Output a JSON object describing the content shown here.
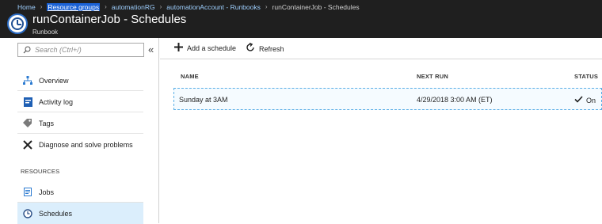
{
  "breadcrumb": [
    {
      "label": "Home",
      "style": "link"
    },
    {
      "label": "Resource groups",
      "style": "active-link"
    },
    {
      "label": "automationRG",
      "style": "link"
    },
    {
      "label": "automationAccount - Runbooks",
      "style": "link"
    },
    {
      "label": "runContainerJob - Schedules",
      "style": "plain"
    }
  ],
  "header": {
    "title": "runContainerJob - Schedules",
    "subtitle": "Runbook",
    "icon": "clock-icon"
  },
  "sidebar": {
    "search_placeholder": "Search (Ctrl+/)",
    "collapse_glyph": "«",
    "items": [
      {
        "label": "Overview",
        "icon": "overview-icon"
      },
      {
        "label": "Activity log",
        "icon": "activity-log-icon"
      },
      {
        "label": "Tags",
        "icon": "tag-icon"
      },
      {
        "label": "Diagnose and solve problems",
        "icon": "wrench-icon"
      }
    ],
    "section_label": "RESOURCES",
    "resource_items": [
      {
        "label": "Jobs",
        "icon": "jobs-icon"
      },
      {
        "label": "Schedules",
        "icon": "clock-icon",
        "selected": true
      }
    ]
  },
  "toolbar": {
    "add_label": "Add a schedule",
    "refresh_label": "Refresh"
  },
  "table": {
    "columns": [
      "NAME",
      "NEXT RUN",
      "STATUS"
    ],
    "rows": [
      {
        "name": "Sunday at 3AM",
        "next_run": "4/29/2018 3:00 AM (ET)",
        "status": "On"
      }
    ]
  },
  "colors": {
    "header_bg": "#1f1f1f",
    "accent": "#1b62d6",
    "selected_bg": "#dbeefc"
  }
}
